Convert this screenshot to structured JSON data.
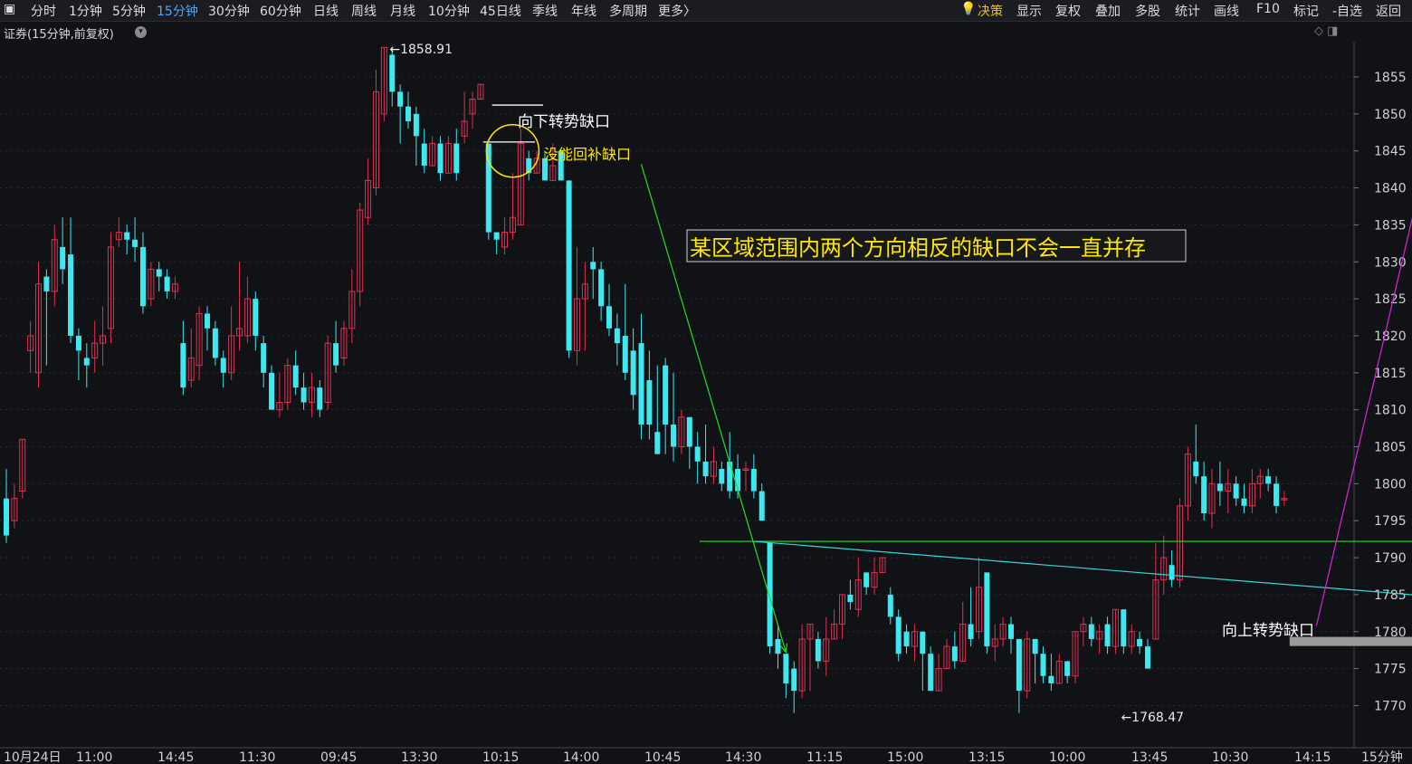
{
  "toolbar": {
    "left_icon": "window-icon",
    "periods": [
      "分时",
      "1分钟",
      "5分钟",
      "15分钟",
      "30分钟",
      "60分钟",
      "日线",
      "周线",
      "月线",
      "10分钟",
      "45日线",
      "季线",
      "年线",
      "多周期",
      "更多〉"
    ],
    "active_period": "15分钟",
    "decision_label": "决策",
    "right_items": [
      "显示",
      "复权",
      "叠加",
      "多股",
      "统计",
      "画线",
      "F10",
      "标记",
      "-自选",
      "返回"
    ]
  },
  "chart_header": "证券(15分钟,前复权)",
  "period_label": "15分钟",
  "colors": {
    "up": "#e03050",
    "down": "#3de8f0",
    "grid": "#2a2b31",
    "annotation_yellow": "#ffe800",
    "line_green": "#22e022",
    "line_cyan": "#33d8d8",
    "arrow_magenta": "#e020e0"
  },
  "chart_data": {
    "type": "candlestick",
    "y_axis_ticks": [
      1855,
      1850,
      1845,
      1840,
      1835,
      1830,
      1825,
      1820,
      1815,
      1810,
      1805,
      1800,
      1795,
      1790,
      1785,
      1780,
      1775,
      1770
    ],
    "ylim": [
      1766.5,
      1859.5
    ],
    "x_tick_labels": [
      "10月24日",
      "11:00",
      "14:45",
      "11:30",
      "09:45",
      "13:30",
      "10:15",
      "14:00",
      "10:45",
      "14:30",
      "11:15",
      "15:00",
      "13:15",
      "10:00",
      "13:45",
      "10:30",
      "14:15"
    ],
    "candles": [
      [
        1798,
        1793,
        1802,
        1792
      ],
      [
        1795,
        1798,
        1800,
        1794
      ],
      [
        1799,
        1806,
        1806,
        1798
      ],
      [
        1818,
        1820,
        1822,
        1815
      ],
      [
        1815,
        1827,
        1830,
        1813
      ],
      [
        1828,
        1826,
        1829,
        1816
      ],
      [
        1826,
        1833,
        1835,
        1824
      ],
      [
        1832,
        1829,
        1836,
        1827
      ],
      [
        1831,
        1820,
        1836,
        1819
      ],
      [
        1820,
        1818,
        1821,
        1814
      ],
      [
        1817,
        1816,
        1819,
        1813
      ],
      [
        1817,
        1819,
        1822,
        1815
      ],
      [
        1819,
        1820,
        1824,
        1816
      ],
      [
        1821,
        1832,
        1834,
        1819
      ],
      [
        1833,
        1834,
        1836,
        1832
      ],
      [
        1834,
        1833,
        1835,
        1831
      ],
      [
        1833,
        1832,
        1836,
        1830
      ],
      [
        1832,
        1824,
        1834,
        1823
      ],
      [
        1825,
        1829,
        1830,
        1824
      ],
      [
        1829,
        1828,
        1830,
        1826
      ],
      [
        1828,
        1826,
        1829,
        1825
      ],
      [
        1826,
        1827,
        1828,
        1825
      ],
      [
        1819,
        1813,
        1822,
        1812
      ],
      [
        1814,
        1817,
        1821,
        1813
      ],
      [
        1816,
        1823,
        1824,
        1814
      ],
      [
        1823,
        1821,
        1824,
        1818
      ],
      [
        1821,
        1817,
        1822,
        1816
      ],
      [
        1817,
        1815,
        1818,
        1813
      ],
      [
        1815,
        1820,
        1824,
        1814
      ],
      [
        1820,
        1821,
        1830,
        1818
      ],
      [
        1820,
        1825,
        1828,
        1819
      ],
      [
        1825,
        1820,
        1826,
        1818
      ],
      [
        1819,
        1815,
        1820,
        1813
      ],
      [
        1815,
        1810,
        1816,
        1810
      ],
      [
        1810,
        1811,
        1815,
        1809
      ],
      [
        1811,
        1816,
        1817,
        1810
      ],
      [
        1816,
        1813,
        1818,
        1812
      ],
      [
        1813,
        1811,
        1815,
        1810
      ],
      [
        1811,
        1813,
        1815,
        1809
      ],
      [
        1813,
        1810,
        1814,
        1809
      ],
      [
        1811,
        1819,
        1820,
        1810
      ],
      [
        1819,
        1816,
        1822,
        1815
      ],
      [
        1817,
        1821,
        1822,
        1816
      ],
      [
        1821,
        1826,
        1829,
        1819
      ],
      [
        1826,
        1837,
        1838,
        1824
      ],
      [
        1836,
        1841,
        1844,
        1835
      ],
      [
        1840,
        1853,
        1856,
        1839
      ],
      [
        1850,
        1859,
        1859,
        1849
      ],
      [
        1858,
        1853,
        1859,
        1851
      ],
      [
        1853,
        1851,
        1854,
        1846
      ],
      [
        1851,
        1849,
        1853,
        1848
      ],
      [
        1850,
        1847,
        1851,
        1843
      ],
      [
        1846,
        1843,
        1848,
        1842
      ],
      [
        1843,
        1846,
        1847,
        1843
      ],
      [
        1846,
        1842,
        1847,
        1841
      ],
      [
        1842,
        1846,
        1847,
        1842
      ],
      [
        1846,
        1842,
        1848,
        1841
      ],
      [
        1847,
        1849,
        1853,
        1846
      ],
      [
        1850,
        1852,
        1853,
        1848
      ],
      [
        1852,
        1854,
        1854,
        1852
      ],
      [
        1846,
        1834,
        1846,
        1833
      ],
      [
        1834,
        1833,
        1834,
        1831
      ],
      [
        1832,
        1834,
        1836,
        1831
      ],
      [
        1834,
        1836,
        1842,
        1833
      ],
      [
        1835,
        1846,
        1848,
        1835
      ],
      [
        1844,
        1842,
        1845,
        1841
      ],
      [
        1842,
        1844,
        1845,
        1842
      ],
      [
        1844,
        1841,
        1845,
        1841
      ],
      [
        1841,
        1843,
        1846,
        1841
      ],
      [
        1845,
        1841,
        1845,
        1841
      ],
      [
        1841,
        1818,
        1841,
        1817
      ],
      [
        1818,
        1825,
        1832,
        1816
      ],
      [
        1825,
        1827,
        1830,
        1818
      ],
      [
        1830,
        1829,
        1832,
        1825
      ],
      [
        1829,
        1824,
        1830,
        1822
      ],
      [
        1824,
        1821,
        1827,
        1820
      ],
      [
        1821,
        1819,
        1823,
        1816
      ],
      [
        1820,
        1815,
        1827,
        1814
      ],
      [
        1818,
        1812,
        1821,
        1810
      ],
      [
        1819,
        1808,
        1823,
        1806
      ],
      [
        1814,
        1808,
        1818,
        1806
      ],
      [
        1807,
        1804,
        1816,
        1805
      ],
      [
        1816,
        1808,
        1817,
        1804
      ],
      [
        1808,
        1805,
        1815,
        1803
      ],
      [
        1805,
        1809,
        1810,
        1804
      ],
      [
        1809,
        1805,
        1809,
        1802
      ],
      [
        1805,
        1803,
        1807,
        1800
      ],
      [
        1803,
        1801,
        1808,
        1800
      ],
      [
        1801,
        1803,
        1805,
        1800
      ],
      [
        1802,
        1800,
        1803,
        1799
      ],
      [
        1803,
        1799,
        1807,
        1798
      ],
      [
        1802,
        1799,
        1804,
        1798
      ],
      [
        1802,
        1802,
        1803,
        1799
      ],
      [
        1802,
        1799,
        1804,
        1798
      ],
      [
        1799,
        1795,
        1800,
        1795
      ],
      [
        1792,
        1778,
        1792,
        1777
      ],
      [
        1779,
        1777,
        1781,
        1775
      ],
      [
        1777,
        1773,
        1777,
        1771
      ],
      [
        1775,
        1772,
        1776,
        1769
      ],
      [
        1772,
        1779,
        1781,
        1771
      ],
      [
        1779,
        1781,
        1781,
        1772
      ],
      [
        1779,
        1776,
        1780,
        1775
      ],
      [
        1776,
        1779,
        1782,
        1774
      ],
      [
        1779,
        1781,
        1783,
        1779
      ],
      [
        1781,
        1785,
        1785,
        1779
      ],
      [
        1785,
        1784,
        1787,
        1783
      ],
      [
        1783,
        1787,
        1790,
        1782
      ],
      [
        1788,
        1786,
        1788,
        1785
      ],
      [
        1786,
        1788,
        1790,
        1785
      ],
      [
        1788,
        1790,
        1790,
        1788
      ],
      [
        1785,
        1782,
        1786,
        1781
      ],
      [
        1782,
        1777,
        1783,
        1776
      ],
      [
        1780,
        1778,
        1781,
        1777
      ],
      [
        1778,
        1780,
        1781,
        1776
      ],
      [
        1780,
        1777,
        1780,
        1772
      ],
      [
        1777,
        1772,
        1778,
        1772
      ],
      [
        1772,
        1775,
        1777,
        1772
      ],
      [
        1775,
        1778,
        1779,
        1775
      ],
      [
        1778,
        1776,
        1780,
        1775
      ],
      [
        1776,
        1781,
        1784,
        1776
      ],
      [
        1781,
        1779,
        1786,
        1778
      ],
      [
        1780,
        1786,
        1790,
        1779
      ],
      [
        1788,
        1778,
        1788,
        1777
      ],
      [
        1778,
        1779,
        1781,
        1776
      ],
      [
        1779,
        1781,
        1782,
        1778
      ],
      [
        1781,
        1779,
        1782,
        1777
      ],
      [
        1779,
        1772,
        1779,
        1769
      ],
      [
        1772,
        1779,
        1780,
        1771
      ],
      [
        1779,
        1777,
        1779,
        1773
      ],
      [
        1777,
        1774,
        1778,
        1773
      ],
      [
        1774,
        1773,
        1777,
        1772
      ],
      [
        1773,
        1776,
        1777,
        1773
      ],
      [
        1776,
        1774,
        1776,
        1773
      ],
      [
        1774,
        1780,
        1780,
        1773
      ],
      [
        1780,
        1781,
        1782,
        1778
      ],
      [
        1781,
        1779,
        1782,
        1778
      ],
      [
        1779,
        1780,
        1781,
        1777
      ],
      [
        1781,
        1778,
        1782,
        1777
      ],
      [
        1778,
        1783,
        1783,
        1777
      ],
      [
        1783,
        1778,
        1783,
        1777
      ],
      [
        1778,
        1780,
        1781,
        1777
      ],
      [
        1779,
        1778,
        1780,
        1777
      ],
      [
        1778,
        1775,
        1779,
        1775
      ],
      [
        1779,
        1787,
        1792,
        1779
      ],
      [
        1787,
        1790,
        1793,
        1785
      ],
      [
        1789,
        1787,
        1791,
        1786
      ],
      [
        1787,
        1797,
        1798,
        1786
      ],
      [
        1797,
        1804,
        1805,
        1795
      ],
      [
        1803,
        1801,
        1808,
        1800
      ],
      [
        1801,
        1796,
        1803,
        1795
      ],
      [
        1796,
        1800,
        1802,
        1794
      ],
      [
        1800,
        1799,
        1803,
        1797
      ],
      [
        1799,
        1800,
        1802,
        1796
      ],
      [
        1800,
        1798,
        1801,
        1797
      ],
      [
        1798,
        1797,
        1800,
        1796
      ],
      [
        1797,
        1800,
        1802,
        1796
      ],
      [
        1800,
        1801,
        1802,
        1798
      ],
      [
        1801,
        1800,
        1802,
        1799
      ],
      [
        1800,
        1797,
        1801,
        1796
      ],
      [
        1798,
        1798,
        1799,
        1797
      ]
    ],
    "price_labels": [
      {
        "text": "1858.91",
        "candle": 47,
        "y": 1858.91
      },
      {
        "text": "1768.47",
        "candle": 138,
        "y": 1768.47
      },
      {
        "text": "1778.30 - 1779.04",
        "candle": 178,
        "y": 1776.8
      }
    ],
    "annotations": {
      "gap_down_label": "向下转势缺口",
      "not_filled_label": "没能回补缺口",
      "main_note": "某区域范围内两个方向相反的缺口不会一直并存",
      "gap_up_label": "向上转势缺口"
    },
    "lines": {
      "green_support": [
        [
          93,
          1792.2
        ],
        [
          185,
          1792.2
        ]
      ],
      "cyan_trend": [
        [
          93,
          1792.2
        ],
        [
          185,
          1784.1
        ]
      ],
      "green_arrow": [
        [
          79,
          1843.2
        ],
        [
          97,
          1777.2
        ]
      ],
      "magenta_arrow": [
        [
          163,
          1780.8
        ],
        [
          177,
          1845.5
        ]
      ],
      "gap_down_marks": [
        [
          61,
          1851.2
        ],
        [
          66,
          1851.2
        ],
        [
          61,
          1846.2
        ],
        [
          66,
          1846.2
        ]
      ],
      "gap_up_band": [
        [
          160,
          1778.3
        ],
        [
          185,
          1779.04
        ]
      ]
    }
  }
}
